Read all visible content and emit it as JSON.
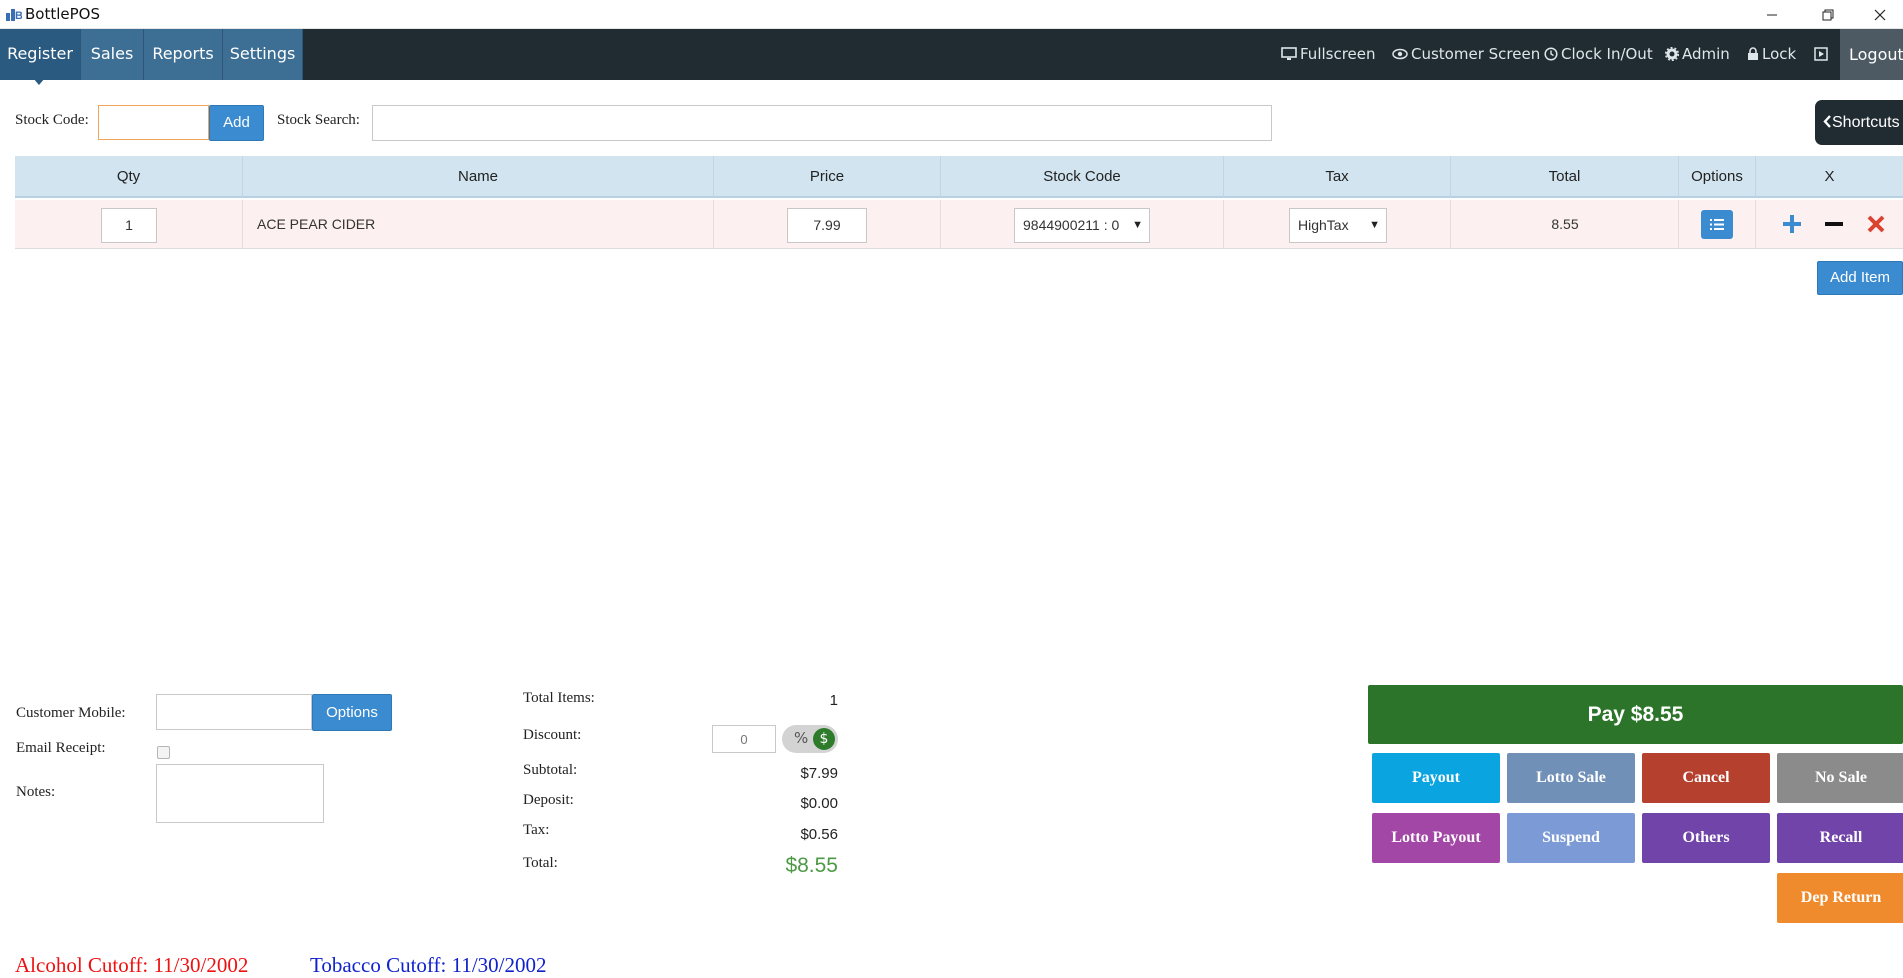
{
  "window": {
    "title": "BottlePOS"
  },
  "nav": {
    "tabs": [
      "Register",
      "Sales",
      "Reports",
      "Settings"
    ],
    "right": {
      "fullscreen": "Fullscreen",
      "customer_screen": "Customer Screen",
      "clock": "Clock In/Out",
      "admin": "Admin",
      "lock": "Lock",
      "logout": "Logout"
    }
  },
  "stock": {
    "code_label": "Stock Code:",
    "code_value": "",
    "add_label": "Add",
    "search_label": "Stock Search:",
    "search_value": "",
    "shortcuts_label": "Shortcuts"
  },
  "table": {
    "headers": [
      "Qty",
      "Name",
      "Price",
      "Stock Code",
      "Tax",
      "Total",
      "Options",
      "X"
    ],
    "rows": [
      {
        "qty": "1",
        "name": "ACE PEAR CIDER",
        "price": "7.99",
        "stock_code": "9844900211 : 0",
        "tax": "HighTax",
        "total": "8.55"
      }
    ],
    "add_item_label": "Add Item"
  },
  "customer": {
    "mobile_label": "Customer Mobile:",
    "mobile_value": "",
    "options_label": "Options",
    "email_label": "Email Receipt:",
    "email_checked": false,
    "notes_label": "Notes:",
    "notes_value": ""
  },
  "summary": {
    "total_items_label": "Total Items:",
    "total_items": "1",
    "discount_label": "Discount:",
    "discount_placeholder": "0",
    "discount_pct_symbol": "%",
    "discount_dollar_symbol": "$",
    "subtotal_label": "Subtotal:",
    "subtotal": "$7.99",
    "deposit_label": "Deposit:",
    "deposit": "$0.00",
    "tax_label": "Tax:",
    "tax": "$0.56",
    "total_label": "Total:",
    "total": "$8.55"
  },
  "actions": {
    "pay_label": "Pay $8.55",
    "buttons": [
      {
        "label": "Payout",
        "color": "#0aa4e0"
      },
      {
        "label": "Lotto Sale",
        "color": "#7190b8"
      },
      {
        "label": "Cancel",
        "color": "#b5402e"
      },
      {
        "label": "No Sale",
        "color": "#8b8b8b"
      },
      {
        "label": "Lotto Payout",
        "color": "#a347a6"
      },
      {
        "label": "Suspend",
        "color": "#7b9ad6"
      },
      {
        "label": "Others",
        "color": "#7044a8"
      },
      {
        "label": "Recall",
        "color": "#7044a8"
      },
      {
        "label": "Dep Return",
        "color": "#ef8b2c"
      }
    ]
  },
  "cutoffs": {
    "alcohol": "Alcohol Cutoff: 11/30/2002",
    "alcohol_color": "#ee1111",
    "tobacco": "Tobacco Cutoff: 11/30/2002",
    "tobacco_color": "#1122cc"
  },
  "colors": {
    "navbar": "#202b32",
    "tab": "#3d6f95",
    "pay": "#2b7429",
    "primary": "#3b8bd0"
  }
}
